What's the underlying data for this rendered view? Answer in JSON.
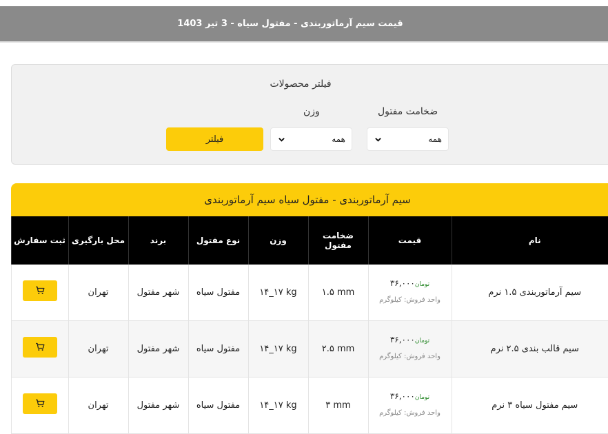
{
  "header": {
    "title": "قیمت سیم آرماتوربندی - مفتول سیاه - 3 تیر 1403"
  },
  "filter": {
    "title": "فیلتر محصولات",
    "thickness_label": "ضخامت مفتول",
    "weight_label": "وزن",
    "thickness_value": "همه",
    "weight_value": "همه",
    "button_label": "فیلتر"
  },
  "products": {
    "banner": "سیم آرماتوربندی - مفتول سیاه  سیم آرماتوربندی",
    "columns": [
      "نام",
      "قیمت",
      "ضخامت مفتول",
      "وزن",
      "نوع مفتول",
      "برند",
      "محل بارگیری",
      "ثبت سفارش"
    ],
    "rows": [
      {
        "name": "سیم آرماتوربندی ۱.۵ نرم",
        "price": "۳۶,۰۰۰",
        "currency": "تومان",
        "unit": "واحد فروش: کیلوگرم",
        "thickness": "۱.۵ mm",
        "weight": "۱۴_۱۷ kg",
        "type": "مفتول سیاه",
        "brand": "شهر مفتول",
        "location": "تهران"
      },
      {
        "name": "سیم قالب بندی ۲.۵ نرم",
        "price": "۳۶,۰۰۰",
        "currency": "تومان",
        "unit": "واحد فروش: کیلوگرم",
        "thickness": "۲.۵ mm",
        "weight": "۱۴_۱۷ kg",
        "type": "مفتول سیاه",
        "brand": "شهر مفتول",
        "location": "تهران"
      },
      {
        "name": "سیم مفتول سیاه ۳ نرم",
        "price": "۳۶,۰۰۰",
        "currency": "تومان",
        "unit": "واحد فروش: کیلوگرم",
        "thickness": "۳ mm",
        "weight": "۱۴_۱۷ kg",
        "type": "مفتول سیاه",
        "brand": "شهر مفتول",
        "location": "تهران"
      }
    ]
  },
  "icons": {
    "select_chevron": "chevron-down-icon",
    "cart": "cart-icon"
  },
  "colors": {
    "header_bg": "#8a8a8a",
    "accent": "#fccc0a",
    "table_header_bg": "#000000",
    "currency_text": "#2e8b2e"
  }
}
